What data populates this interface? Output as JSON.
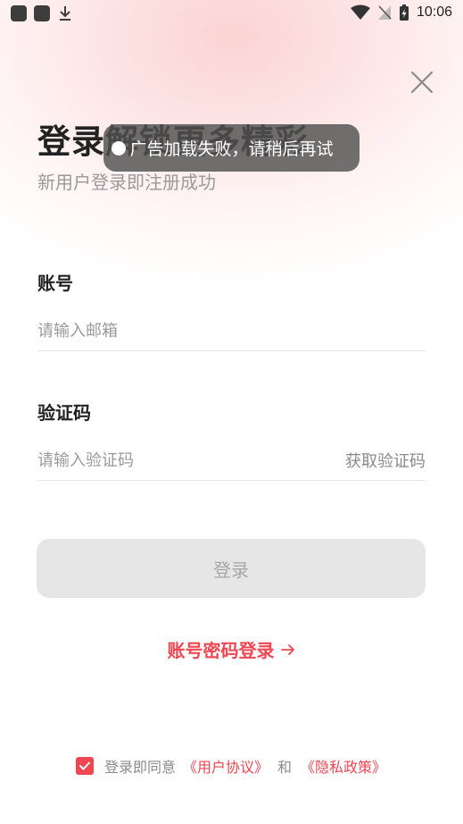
{
  "status_bar": {
    "time": "10:06"
  },
  "header": {
    "title": "登录解锁更多精彩",
    "subtitle": "新用户登录即注册成功"
  },
  "toast": {
    "text": "广告加载失败，请稍后再试"
  },
  "account": {
    "label": "账号",
    "placeholder": "请输入邮箱"
  },
  "code": {
    "label": "验证码",
    "placeholder": "请输入验证码",
    "get_code": "获取验证码"
  },
  "login_button": "登录",
  "password_login": "账号密码登录",
  "agreement": {
    "prefix": "登录即同意",
    "user_agreement": "《用户协议》",
    "and": "和",
    "privacy_policy": "《隐私政策》",
    "checked": true
  },
  "colors": {
    "accent": "#ee4752",
    "disabled_button": "#e6e6e6"
  }
}
